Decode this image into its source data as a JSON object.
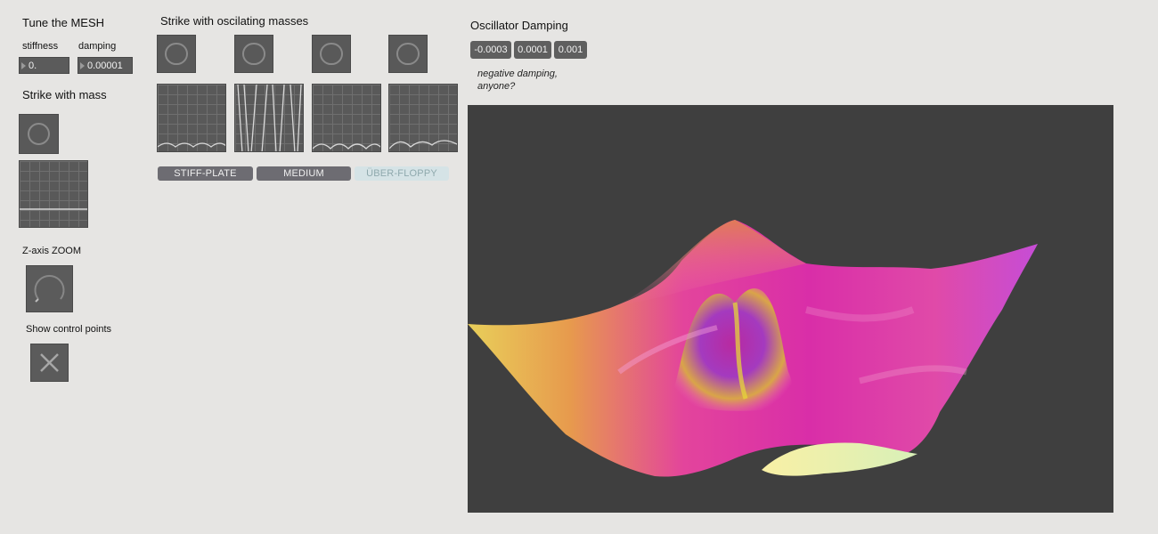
{
  "mesh": {
    "title": "Tune the MESH",
    "stiffness_label": "stiffness",
    "stiffness_value": "0.",
    "damping_label": "damping",
    "damping_value": "0.00001"
  },
  "strike_mass": {
    "title": "Strike with mass"
  },
  "zoom": {
    "title": "Z-axis ZOOM",
    "level": 0.05
  },
  "control_points": {
    "title": "Show control points",
    "checked": true
  },
  "oscillating": {
    "title": "Strike  with oscilating masses",
    "presets": [
      "STIFF-PLATE",
      "MEDIUM",
      "ÜBER-FLOPPY"
    ],
    "active_presets": [
      true,
      true,
      false
    ]
  },
  "osc_damping": {
    "title": "Oscillator Damping",
    "values": [
      "-0.0003",
      "0.0001",
      "0.001"
    ],
    "note_line1": "negative damping,",
    "note_line2": "anyone?"
  },
  "colors": {
    "panel_bg": "#e6e5e3",
    "control_bg": "#595959",
    "render_bg": "#3f3f3f",
    "preset_button": "#6d6c72",
    "preset_button_inactive": "#d5e3e6"
  },
  "icons": {
    "bang": "ring-icon",
    "toggle": "x-icon",
    "dial": "dial-icon"
  }
}
